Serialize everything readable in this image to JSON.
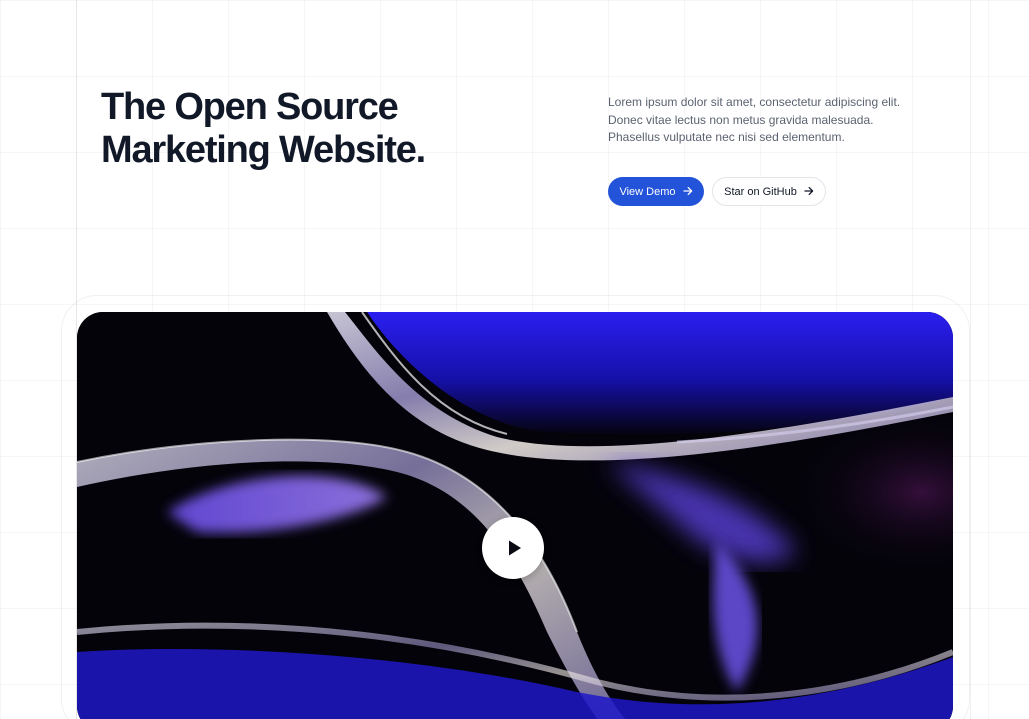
{
  "hero": {
    "title_line1": "The Open Source",
    "title_line2": "Marketing Website.",
    "description_line1": "Lorem ipsum dolor sit amet, consectetur adipiscing elit.",
    "description_line2": "Donec vitae lectus non metus gravida malesuada.",
    "description_line3": "Phasellus vulputate nec nisi sed elementum."
  },
  "actions": {
    "demo_label": "View Demo",
    "github_label": "Star on GitHub",
    "arrow_icon": "arrow-right-icon"
  },
  "media": {
    "play_icon": "play-icon",
    "image": "abstract-glass-waves-image"
  },
  "colors": {
    "primary": "#2353d8",
    "heading": "#111827",
    "body_text": "#5b6270",
    "media_blue": "#1f18d6",
    "media_purple": "#7a5ce6"
  }
}
